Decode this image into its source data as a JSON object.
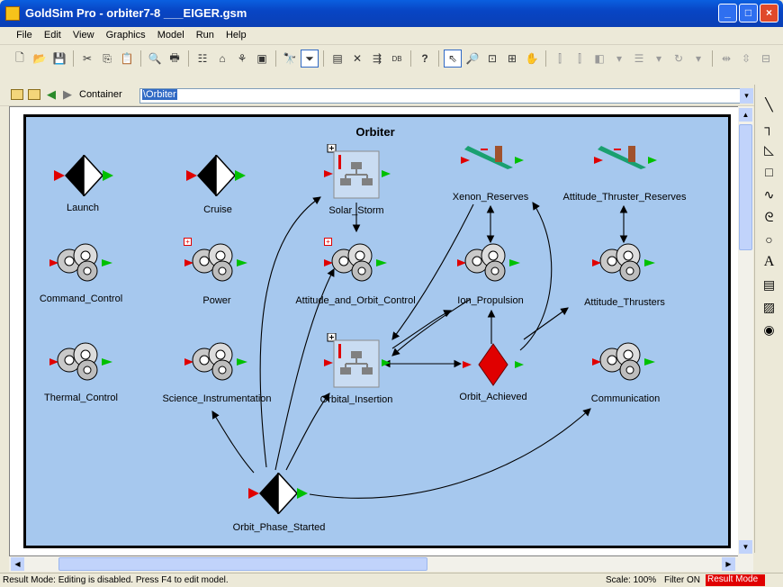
{
  "window": {
    "title": "GoldSim Pro - orbiter7-8 ___EIGER.gsm"
  },
  "menu": [
    "File",
    "Edit",
    "View",
    "Graphics",
    "Model",
    "Run",
    "Help"
  ],
  "address": {
    "label": "Container",
    "path": "\\Orbiter"
  },
  "canvas": {
    "title": "Orbiter"
  },
  "elements": {
    "launch": "Launch",
    "cruise": "Cruise",
    "solar_storm": "Solar_Storm",
    "xenon_reserves": "Xenon_Reserves",
    "attitude_thruster_reserves": "Attitude_Thruster_Reserves",
    "command_control": "Command_Control",
    "power": "Power",
    "attitude_orbit_control": "Attitude_and_Orbit_Control",
    "ion_propulsion": "Ion_Propulsion",
    "attitude_thrusters": "Attitude_Thrusters",
    "thermal_control": "Thermal_Control",
    "science_instrumentation": "Science_Instrumentation",
    "orbital_insertion": "Orbital_Insertion",
    "orbit_achieved": "Orbit_Achieved",
    "communication": "Communication",
    "orbit_phase_started": "Orbit_Phase_Started"
  },
  "status": {
    "message": "Result Mode: Editing is disabled. Press F4 to edit model.",
    "scale": "Scale: 100%",
    "filter": "Filter ON",
    "mode": "Result Mode"
  },
  "colors": {
    "canvas_bg": "#a6c8ee",
    "mode_badge": "#e00000",
    "milestone": "#e00000"
  }
}
